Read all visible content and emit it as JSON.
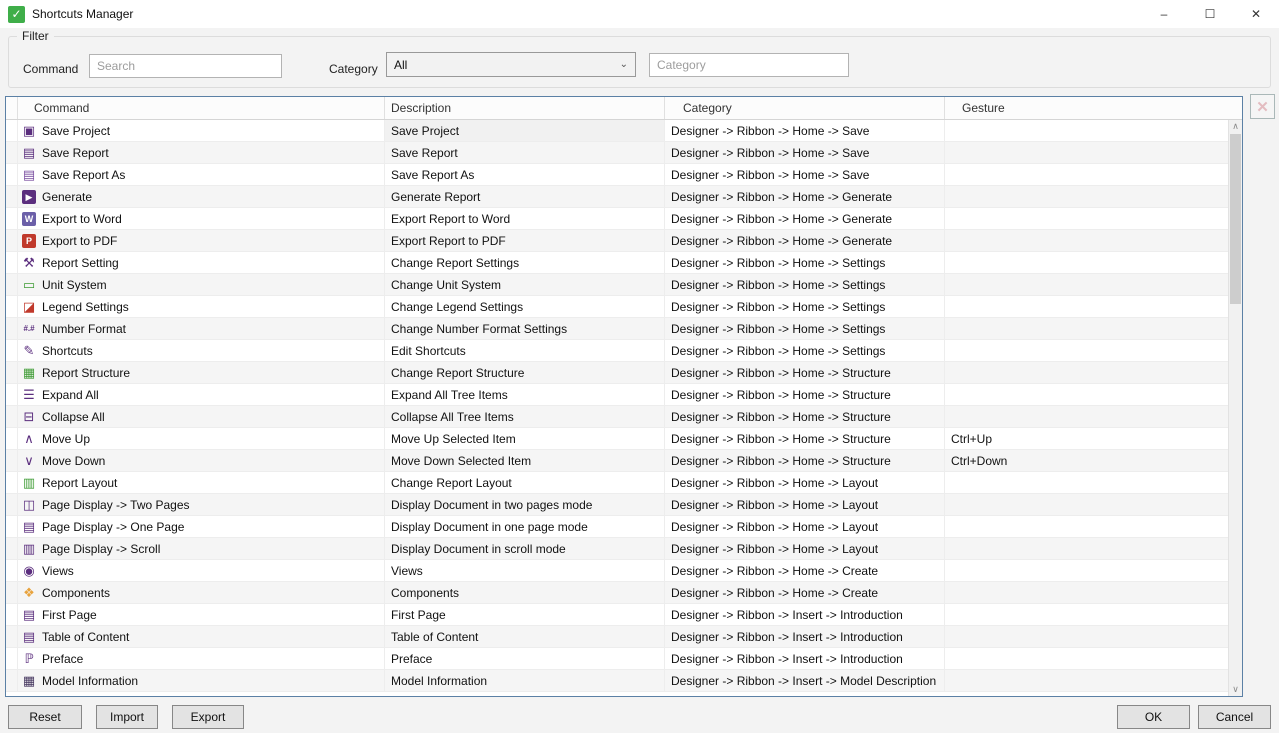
{
  "window": {
    "title": "Shortcuts Manager",
    "app_icon": "check",
    "minimize": "–",
    "maximize": "☐",
    "close": "✕"
  },
  "filter": {
    "legend": "Filter",
    "command_label": "Command",
    "search_placeholder": "Search",
    "category_label": "Category",
    "category_selected": "All",
    "category_placeholder": "Category",
    "dropdown_chevron": "⌄"
  },
  "table": {
    "columns": [
      "Command",
      "Description",
      "Category",
      "Gesture"
    ],
    "rows": [
      {
        "command": "Save Project",
        "description": "Save Project",
        "category": "Designer -> Ribbon -> Home ->  Save",
        "gesture": "",
        "icon": {
          "name": "save-icon",
          "glyph": "▣",
          "color": "#5b2e7e"
        }
      },
      {
        "command": "Save Report",
        "description": "Save Report",
        "category": "Designer -> Ribbon -> Home ->  Save",
        "gesture": "",
        "icon": {
          "name": "save-report-icon",
          "glyph": "▤",
          "color": "#5b2e7e"
        }
      },
      {
        "command": "Save Report As",
        "description": "Save Report As",
        "category": "Designer -> Ribbon -> Home ->  Save",
        "gesture": "",
        "icon": {
          "name": "save-report-as-icon",
          "glyph": "▤",
          "color": "#7a4ea0"
        }
      },
      {
        "command": "Generate",
        "description": "Generate Report",
        "category": "Designer -> Ribbon -> Home -> Generate",
        "gesture": "",
        "icon": {
          "name": "generate-icon",
          "glyph": "▶",
          "color": "#ffffff",
          "bg": "#5b2e7e"
        }
      },
      {
        "command": "Export to Word",
        "description": "Export Report to Word",
        "category": "Designer -> Ribbon -> Home -> Generate",
        "gesture": "",
        "icon": {
          "name": "export-word-icon",
          "glyph": "W",
          "color": "#ffffff",
          "bg": "#6b5fa8"
        }
      },
      {
        "command": "Export to PDF",
        "description": "Export Report to PDF",
        "category": "Designer -> Ribbon -> Home -> Generate",
        "gesture": "",
        "icon": {
          "name": "export-pdf-icon",
          "glyph": "P",
          "color": "#ffffff",
          "bg": "#c0392b"
        }
      },
      {
        "command": "Report Setting",
        "description": "Change Report Settings",
        "category": "Designer -> Ribbon -> Home ->  Settings",
        "gesture": "",
        "icon": {
          "name": "report-settings-icon",
          "glyph": "⚒",
          "color": "#5b2e7e"
        }
      },
      {
        "command": "Unit System",
        "description": "Change Unit System",
        "category": "Designer -> Ribbon -> Home ->  Settings",
        "gesture": "",
        "icon": {
          "name": "unit-system-ruler-icon",
          "glyph": "▭",
          "color": "#3f9c35"
        }
      },
      {
        "command": "Legend Settings",
        "description": "Change Legend Settings",
        "category": "Designer -> Ribbon -> Home ->  Settings",
        "gesture": "",
        "icon": {
          "name": "legend-settings-icon",
          "glyph": "◪",
          "color": "#c0392b"
        }
      },
      {
        "command": "Number Format",
        "description": "Change Number Format Settings",
        "category": "Designer -> Ribbon -> Home ->  Settings",
        "gesture": "",
        "icon": {
          "name": "number-format-icon",
          "glyph": "#.#",
          "color": "#5b2e7e",
          "small": true
        }
      },
      {
        "command": "Shortcuts",
        "description": "Edit Shortcuts",
        "category": "Designer -> Ribbon -> Home ->  Settings",
        "gesture": "",
        "icon": {
          "name": "shortcuts-edit-icon",
          "glyph": "✎",
          "color": "#5b2e7e"
        }
      },
      {
        "command": "Report Structure",
        "description": "Change Report Structure",
        "category": "Designer -> Ribbon -> Home -> Structure",
        "gesture": "",
        "icon": {
          "name": "report-structure-icon",
          "glyph": "▦",
          "color": "#3f9c35"
        }
      },
      {
        "command": "Expand All",
        "description": "Expand All Tree Items",
        "category": "Designer -> Ribbon -> Home -> Structure",
        "gesture": "",
        "icon": {
          "name": "expand-all-icon",
          "glyph": "☰",
          "color": "#5b2e7e"
        }
      },
      {
        "command": "Collapse All",
        "description": "Collapse All Tree Items",
        "category": "Designer -> Ribbon -> Home -> Structure",
        "gesture": "",
        "icon": {
          "name": "collapse-all-icon",
          "glyph": "⊟",
          "color": "#5b2e7e"
        }
      },
      {
        "command": "Move Up",
        "description": "Move Up Selected Item",
        "category": "Designer -> Ribbon -> Home -> Structure",
        "gesture": "Ctrl+Up",
        "icon": {
          "name": "move-up-icon",
          "glyph": "∧",
          "color": "#5b2e7e"
        }
      },
      {
        "command": "Move Down",
        "description": "Move Down Selected Item",
        "category": "Designer -> Ribbon -> Home -> Structure",
        "gesture": "Ctrl+Down",
        "icon": {
          "name": "move-down-icon",
          "glyph": "∨",
          "color": "#5b2e7e"
        }
      },
      {
        "command": "Report Layout",
        "description": "Change Report Layout",
        "category": "Designer -> Ribbon -> Home -> Layout",
        "gesture": "",
        "icon": {
          "name": "report-layout-icon",
          "glyph": "▥",
          "color": "#3f9c35"
        }
      },
      {
        "command": "Page Display -> Two Pages",
        "description": "Display Document in two pages mode",
        "category": "Designer -> Ribbon -> Home -> Layout",
        "gesture": "",
        "icon": {
          "name": "two-pages-icon",
          "glyph": "◫",
          "color": "#5b2e7e"
        }
      },
      {
        "command": "Page Display -> One Page",
        "description": "Display Document in one page mode",
        "category": "Designer -> Ribbon -> Home -> Layout",
        "gesture": "",
        "icon": {
          "name": "one-page-icon",
          "glyph": "▤",
          "color": "#5b2e7e"
        }
      },
      {
        "command": "Page Display -> Scroll",
        "description": "Display Document in scroll mode",
        "category": "Designer -> Ribbon -> Home -> Layout",
        "gesture": "",
        "icon": {
          "name": "scroll-page-icon",
          "glyph": "▥",
          "color": "#5b2e7e"
        }
      },
      {
        "command": "Views",
        "description": "Views",
        "category": "Designer -> Ribbon -> Home -> Create",
        "gesture": "",
        "icon": {
          "name": "views-eye-icon",
          "glyph": "◉",
          "color": "#5b2e7e"
        }
      },
      {
        "command": "Components",
        "description": "Components",
        "category": "Designer -> Ribbon -> Home -> Create",
        "gesture": "",
        "icon": {
          "name": "components-icon",
          "glyph": "❖",
          "color": "#e8a33d"
        }
      },
      {
        "command": "First Page",
        "description": "First Page",
        "category": "Designer -> Ribbon -> Insert -> Introduction",
        "gesture": "",
        "icon": {
          "name": "first-page-icon",
          "glyph": "▤",
          "color": "#5b2e7e"
        }
      },
      {
        "command": "Table of Content",
        "description": "Table of Content",
        "category": "Designer -> Ribbon -> Insert -> Introduction",
        "gesture": "",
        "icon": {
          "name": "table-of-content-icon",
          "glyph": "▤",
          "color": "#5b2e7e"
        }
      },
      {
        "command": "Preface",
        "description": "Preface",
        "category": "Designer -> Ribbon -> Insert -> Introduction",
        "gesture": "",
        "icon": {
          "name": "preface-icon",
          "glyph": "ℙ",
          "color": "#5b2e7e"
        }
      },
      {
        "command": "Model Information",
        "description": "Model Information",
        "category": "Designer -> Ribbon -> Insert -> Model Description",
        "gesture": "",
        "icon": {
          "name": "model-information-icon",
          "glyph": "▦",
          "color": "#44355e"
        }
      }
    ]
  },
  "scrollbar": {
    "up_arrow": "∧",
    "down_arrow": "∨"
  },
  "remove_button": {
    "glyph": "✕",
    "state": "disabled"
  },
  "buttons": {
    "reset": "Reset",
    "import": "Import",
    "export": "Export",
    "ok": "OK",
    "cancel": "Cancel"
  },
  "colors": {
    "accent_purple": "#5b2e7e",
    "accent_green": "#3f9c35",
    "app_icon_green": "#3fae49",
    "table_border_blue": "#5b80a5",
    "row_alt": "#f5f5f5"
  }
}
